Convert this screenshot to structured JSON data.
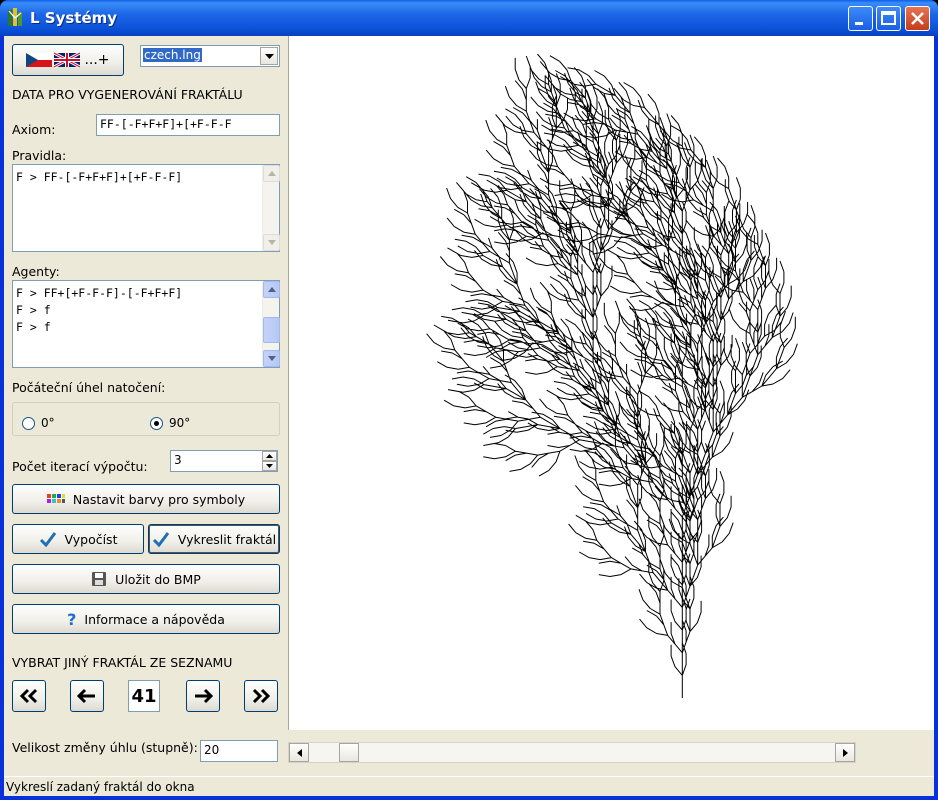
{
  "window": {
    "title": "L Systémy"
  },
  "language": {
    "flag_button_label": "...+",
    "selected": "czech.lng"
  },
  "section_title": "DATA PRO VYGENEROVÁNÍ FRAKTÁLU",
  "axiom": {
    "label": "Axiom:",
    "value": "FF-[-F+F+F]+[+F-F-F"
  },
  "rules": {
    "label": "Pravidla:",
    "lines": [
      "F > FF-[-F+F+F]+[+F-F-F]"
    ]
  },
  "agents": {
    "label": "Agenty:",
    "lines": [
      "F > FF+[+F-F-F]-[-F+F+F]",
      "F > f",
      "F > f"
    ]
  },
  "initial_angle": {
    "label": "Počáteční úhel natočení:",
    "options": [
      "0°",
      "90°"
    ],
    "selected": "90°"
  },
  "iterations": {
    "label": "Počet iterací výpočtu:",
    "value": "3"
  },
  "buttons": {
    "set_colors": "Nastavit barvy pro symboly",
    "compute": "Vypočíst",
    "draw": "Vykreslit fraktál",
    "save_bmp": "Uložit do BMP",
    "info_help": "Informace a nápověda"
  },
  "fractal_list": {
    "title": "VYBRAT JINÝ FRAKTÁL ZE SEZNAMU",
    "index": "41"
  },
  "angle_change": {
    "label": "Velikost změny úhlu (stupně):",
    "value": "20"
  },
  "status": {
    "text": "Vykreslí zadaný fraktál do okna"
  },
  "colors": {
    "titlebar": "#0a52d8",
    "panel": "#ece9d8",
    "stroke": "#000000"
  }
}
